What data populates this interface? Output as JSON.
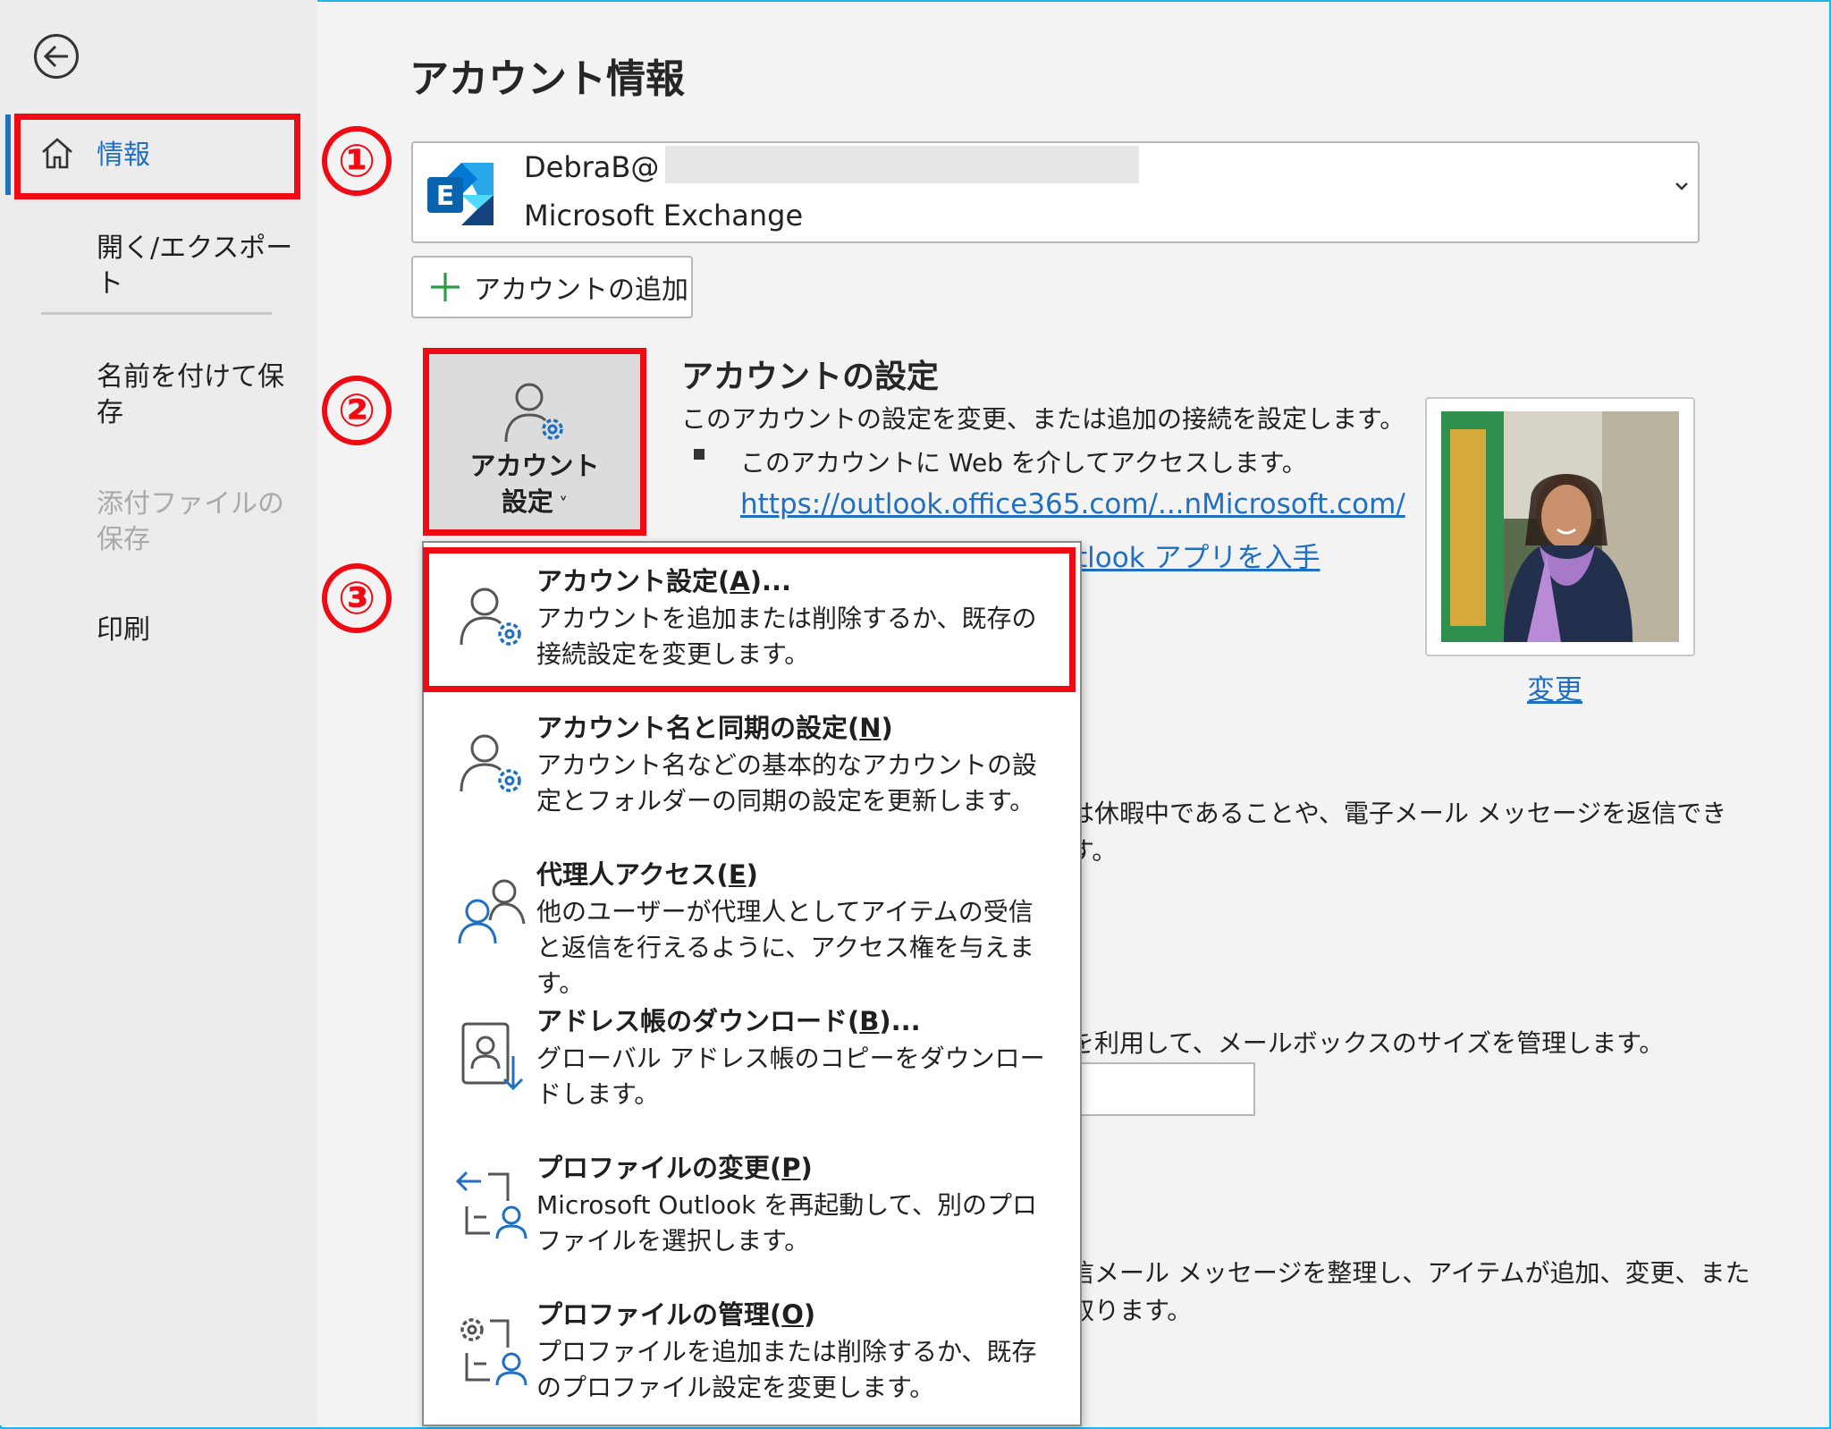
{
  "page": {
    "title": "アカウント情報"
  },
  "nav": {
    "items": [
      {
        "label": "情報"
      },
      {
        "label": "開く/エクスポート"
      },
      {
        "label": "名前を付けて保存"
      },
      {
        "label": "添付ファイルの保存"
      },
      {
        "label": "印刷"
      }
    ]
  },
  "annotations": {
    "one": "①",
    "two": "②",
    "three": "③"
  },
  "account": {
    "email": "DebraB@",
    "type": "Microsoft Exchange",
    "add_label": "アカウントの追加"
  },
  "account_settings": {
    "button_line1": "アカウント",
    "button_line2": "設定",
    "heading": "アカウントの設定",
    "desc": "このアカウントの設定を変更、または追加の接続を設定します。",
    "bullet": "このアカウントに Web を介してアクセスします。",
    "url": "https://outlook.office365.com/...nMicrosoft.com/",
    "partial_link": "tlook アプリを入手",
    "change_label": "変更"
  },
  "background_text": {
    "auto_reply": "は休暇中であることや、電子メール メッセージを返信でき",
    "auto_reply_end": "す。",
    "mailbox": "を利用して、メールボックスのサイズを管理します。",
    "rules": "信メール メッセージを整理し、アイテムが追加、変更、また",
    "rules_end": "取ります。"
  },
  "menu": {
    "items": [
      {
        "title": "アカウント設定(",
        "key": "A",
        "suffix": ")...",
        "desc": "アカウントを追加または削除するか、既存の接続設定を変更します。",
        "icon": "account-settings-icon"
      },
      {
        "title": "アカウント名と同期の設定(",
        "key": "N",
        "suffix": ")",
        "desc": "アカウント名などの基本的なアカウントの設定とフォルダーの同期の設定を更新します。",
        "icon": "account-sync-icon"
      },
      {
        "title": "代理人アクセス(",
        "key": "E",
        "suffix": ")",
        "desc": "他のユーザーが代理人としてアイテムの受信と返信を行えるように、アクセス権を与えます。",
        "icon": "delegate-icon"
      },
      {
        "title": "アドレス帳のダウンロード(",
        "key": "B",
        "suffix": ")...",
        "desc": "グローバル アドレス帳のコピーをダウンロードします。",
        "icon": "address-book-download-icon"
      },
      {
        "title": "プロファイルの変更(",
        "key": "P",
        "suffix": ")",
        "desc": "Microsoft Outlook を再起動して、別のプロファイルを選択します。",
        "icon": "change-profile-icon"
      },
      {
        "title": "プロファイルの管理(",
        "key": "O",
        "suffix": ")",
        "desc": "プロファイルを追加または削除するか、既存のプロファイル設定を変更します。",
        "icon": "manage-profile-icon"
      }
    ]
  },
  "colors": {
    "accent": "#1f6fc4",
    "annotation_red": "#ef0a14",
    "frame": "#1fb6e8"
  }
}
